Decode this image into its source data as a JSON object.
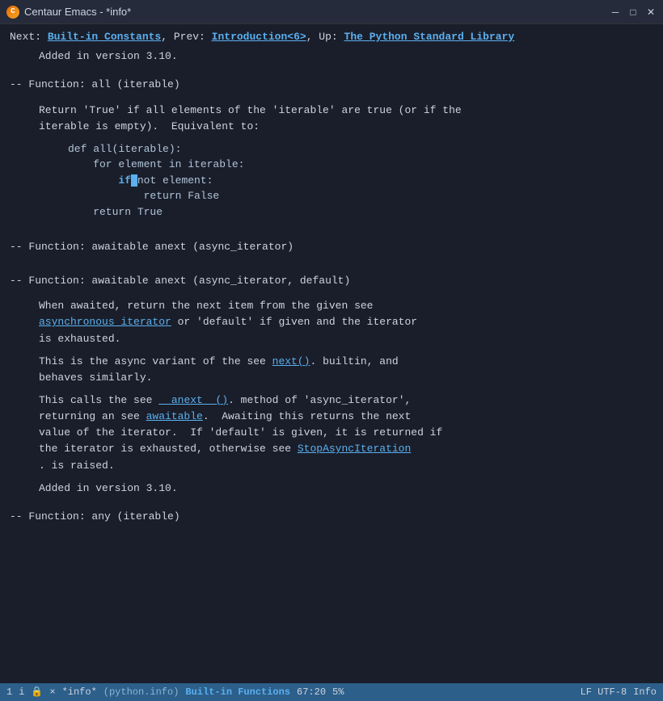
{
  "titlebar": {
    "title": "Centaur Emacs - *info*",
    "minimize_label": "─",
    "maximize_label": "□",
    "close_label": "✕"
  },
  "nav": {
    "prefix": "Next: ",
    "next_link": "Built-in Constants",
    "sep1": ",  Prev: ",
    "prev_link": "Introduction<6>",
    "sep2": ",  Up: ",
    "up_link": "The Python Standard Library"
  },
  "content": {
    "added_310": "Added in version 3.10.",
    "func_all_header": "-- Function: all (iterable)",
    "func_all_desc": "Return 'True' if all elements of the 'iterable' are true (or if the\niterable is empty).  Equivalent to:",
    "code_block": [
      "def all(iterable):",
      "    for element in iterable:",
      "        if not element:",
      "            return False",
      "    return True"
    ],
    "func_awaitable_anext1": "-- Function: awaitable anext (async_iterator)",
    "func_awaitable_anext2": "-- Function: awaitable anext (async_iterator, default)",
    "para1_part1": "When awaited, return the next item from the given see",
    "para1_link": "asynchronous iterator",
    "para1_part2": " or 'default' if given and the iterator\nis exhausted.",
    "para2_part1": "This is the async variant of the see ",
    "para2_link": "next()",
    "para2_part2": ". builtin, and\nbehaves similarly.",
    "para3_part1": "This calls the see ",
    "para3_link1": "__anext__()",
    "para3_part2": ". method of 'async_iterator',\nreturning an see ",
    "para3_link2": "awaitable",
    "para3_part3": ".  Awaiting this returns the next\nvalue of the iterator.  If 'default' is given, it is returned if\nthe iterator is exhausted, otherwise see ",
    "para3_link3": "StopAsyncIteration",
    "para3_part4": "\n. is raised.",
    "added_310b": "Added in version 3.10.",
    "func_any_header": "-- Function: any (iterable)"
  },
  "statusbar": {
    "line_num": "1",
    "icon_i": "i",
    "icon_lock": "🔒",
    "icon_x": "×",
    "filename": "*info*",
    "mode_python": "(python.info)",
    "major_mode": "Built-in Functions",
    "position": "67:20",
    "percent": "5%",
    "encoding": "LF UTF-8",
    "info_label": "Info"
  }
}
